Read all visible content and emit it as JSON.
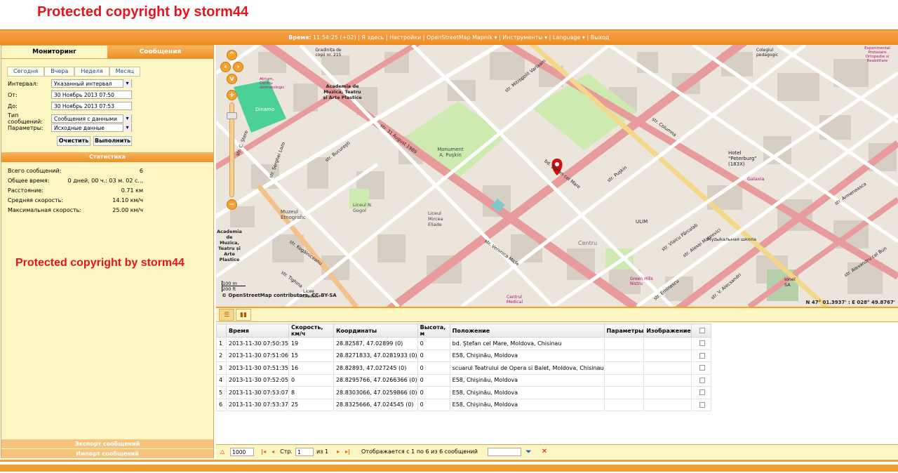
{
  "watermark": "Protected copyright by storm44",
  "topbar": {
    "label": "Время:",
    "time": "11:54:25 (+02)",
    "items": [
      "Я здесь",
      "Настройки",
      "OpenStreetMap Mapnik ▾",
      "Инструменты ▾",
      "Language ▾",
      "Выход"
    ]
  },
  "tabs": {
    "monitoring": "Мониторинг",
    "messages": "Сообщения"
  },
  "period_buttons": [
    "Сегодня",
    "Вчера",
    "Неделя",
    "Месяц"
  ],
  "form": {
    "interval_label": "Интервал:",
    "interval_value": "Указанный интервал",
    "from_label": "От:",
    "from_value": "30 Ноябрь 2013 07:50",
    "to_label": "До:",
    "to_value": "30 Ноябрь 2013 07:53",
    "msgtype_label": "Тип сообщений:",
    "msgtype_value": "Сообщения с данными",
    "params_label": "Параметры:",
    "params_value": "Исходные данные",
    "clear_label": "Очистить",
    "run_label": "Выполнить"
  },
  "stats": {
    "header": "Статистика",
    "rows": [
      {
        "label": "Всего сообщений:",
        "value": "6"
      },
      {
        "label": "Общее время:",
        "value": "0 дней, 00 ч.: 03 м. 02 с..."
      },
      {
        "label": "Расстояние:",
        "value": "0.71 км"
      },
      {
        "label": "Средняя скорость:",
        "value": "14.10 км/ч"
      },
      {
        "label": "Максимальная скорость:",
        "value": "25.00 км/ч"
      }
    ]
  },
  "bottom_buttons": {
    "export": "Экспорт сообщений",
    "import": "Импорт сообщений"
  },
  "map": {
    "attribution": "© OpenStreetMap contributors, CC-BY-SA",
    "coords": "N 47° 01.3937' : E 028° 49.8767'",
    "scale_m": "100 m",
    "scale_ft": "200 ft",
    "labels": [
      "Dinamo",
      "Monument A. Puşkin",
      "Academia de Muzica, Teatru și Arte Plastice",
      "Muzeul Etnografic",
      "Liceul N. Gogol",
      "Liceul Mircea Eliade",
      "Centru",
      "Hotel \"Peterburg\" (183X)",
      "Galaxia",
      "ULIM",
      "bd. Ştefan cel Mare",
      "str. Bucureşti",
      "str. Puşkin",
      "str. 31 August 1989",
      "str. Columna",
      "str. Kogălniceanu",
      "str. Vlaicu Pârcalab",
      "str. Armeneasca",
      "str. Alexandru cel Bun",
      "str. Mitropolit Varlaam",
      "Gradinița de copii nr. 215",
      "str. Veronica Micle",
      "str. C. Stere",
      "Colegiul pedagogic",
      "Experimental Protezare Ortopedie si Reabilitare",
      "Green Hills Nistru",
      "Licee «Prometei»",
      "Centrul Medical",
      "Ionel SA",
      "Муzыkальная школа",
      "str. Alexei Mateevici",
      "str. V. Alecsandri",
      "Atrium, Centru stomatologic",
      "str. Serghei Lazo",
      "str. Eminescu",
      "str. Tighina"
    ]
  },
  "grid": {
    "columns": [
      "",
      "Время",
      "Скорость, км/ч",
      "Координаты",
      "Высота, м",
      "Положение",
      "Параметры",
      "Изображение",
      ""
    ],
    "rows": [
      [
        "1",
        "2013-11-30 07:50:35",
        "19",
        "28.82587, 47.02899 (0)",
        "0",
        "bd. Ştefan cel Mare, Moldova, Chisinau"
      ],
      [
        "2",
        "2013-11-30 07:51:06",
        "15",
        "28.8271833, 47.0281933 (0)",
        "0",
        "E58, Chişinău, Moldova"
      ],
      [
        "3",
        "2013-11-30 07:51:35",
        "16",
        "28.82893, 47.027245 (0)",
        "0",
        "scuarul Teatrului de Opera si Balet, Moldova, Chisinau"
      ],
      [
        "4",
        "2013-11-30 07:52:05",
        "0",
        "28.8295766, 47.0266366 (0)",
        "0",
        "E58, Chişinău, Moldova"
      ],
      [
        "5",
        "2013-11-30 07:53:07",
        "8",
        "28.8303066, 47.0259866 (0)",
        "0",
        "E58, Chişinău, Moldova"
      ],
      [
        "6",
        "2013-11-30 07:53:37",
        "25",
        "28.8325666, 47.024545 (0)",
        "0",
        "E58, Chişinău, Moldova"
      ]
    ]
  },
  "pager": {
    "per_page": "1000",
    "page_label": "Стр.",
    "page_value": "1",
    "of_label": "из 1",
    "info": "Отображается с 1 по 6 из 6 сообщений"
  }
}
